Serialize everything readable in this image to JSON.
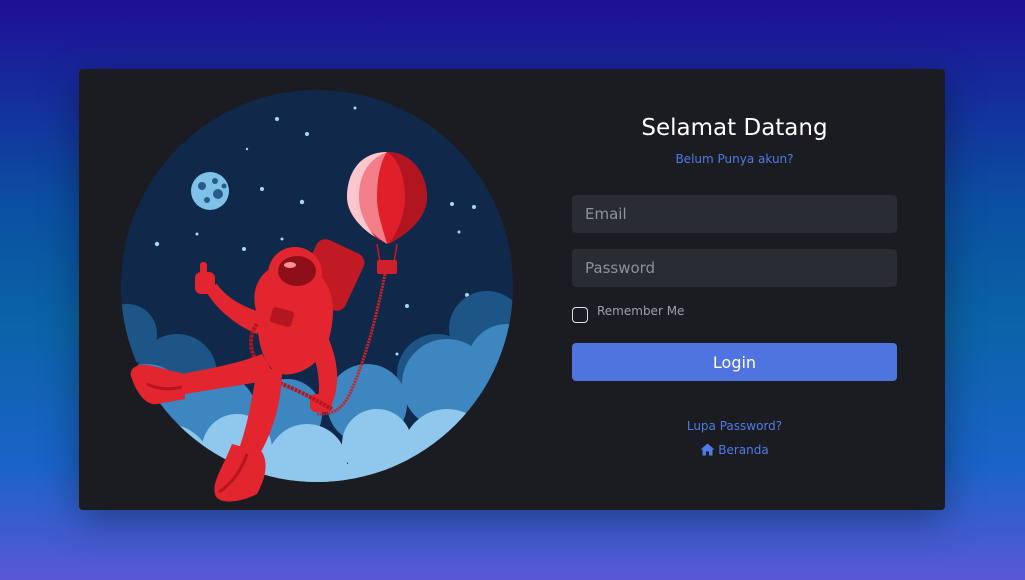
{
  "login": {
    "title": "Selamat Datang",
    "register_link": "Belum Punya akun?",
    "email_placeholder": "Email",
    "password_placeholder": "Password",
    "remember_label": "Remember Me",
    "login_button": "Login",
    "forgot_link": "Lupa Password?",
    "home_link": "Beranda"
  },
  "colors": {
    "card_background": "#1b1c22",
    "accent": "#4f74e0",
    "link": "#4e7be6",
    "input_background": "#2a2c33"
  },
  "icons": {
    "home": "home-icon",
    "illustration": "astronaut-balloon-illustration"
  }
}
